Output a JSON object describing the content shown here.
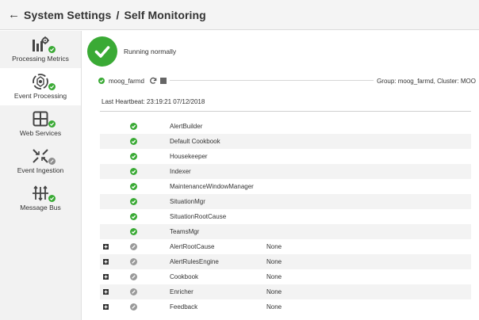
{
  "header": {
    "back_arrow": "←",
    "title_part1": "System Settings",
    "title_sep": "/",
    "title_part2": "Self Monitoring"
  },
  "sidebar": {
    "items": [
      {
        "label": "Processing Metrics",
        "icon": "processing-metrics-icon",
        "status": "ok"
      },
      {
        "label": "Event Processing",
        "icon": "event-processing-icon",
        "status": "ok",
        "active": true
      },
      {
        "label": "Web Services",
        "icon": "web-services-icon",
        "status": "ok"
      },
      {
        "label": "Event Ingestion",
        "icon": "event-ingestion-icon",
        "status": "off"
      },
      {
        "label": "Message Bus",
        "icon": "message-bus-icon",
        "status": "ok"
      }
    ]
  },
  "status": {
    "text": "Running normally"
  },
  "panel": {
    "process_name": "moog_farmd",
    "group_info": "Group: moog_farmd, Cluster: MOO",
    "heartbeat": "Last Heartbeat: 23:19:21 07/12/2018"
  },
  "modules": [
    {
      "name": "AlertBuilder",
      "status": "ok",
      "value": ""
    },
    {
      "name": "Default Cookbook",
      "status": "ok",
      "value": ""
    },
    {
      "name": "Housekeeper",
      "status": "ok",
      "value": ""
    },
    {
      "name": "Indexer",
      "status": "ok",
      "value": ""
    },
    {
      "name": "MaintenanceWindowManager",
      "status": "ok",
      "value": ""
    },
    {
      "name": "SituationMgr",
      "status": "ok",
      "value": ""
    },
    {
      "name": "SituationRootCause",
      "status": "ok",
      "value": ""
    },
    {
      "name": "TeamsMgr",
      "status": "ok",
      "value": ""
    },
    {
      "name": "AlertRootCause",
      "status": "off",
      "value": "None"
    },
    {
      "name": "AlertRulesEngine",
      "status": "off",
      "value": "None"
    },
    {
      "name": "Cookbook",
      "status": "off",
      "value": "None"
    },
    {
      "name": "Enricher",
      "status": "off",
      "value": "None"
    },
    {
      "name": "Feedback",
      "status": "off",
      "value": "None"
    }
  ],
  "colors": {
    "ok_green": "#3aaa35",
    "disabled_gray": "#9a9a9a"
  }
}
